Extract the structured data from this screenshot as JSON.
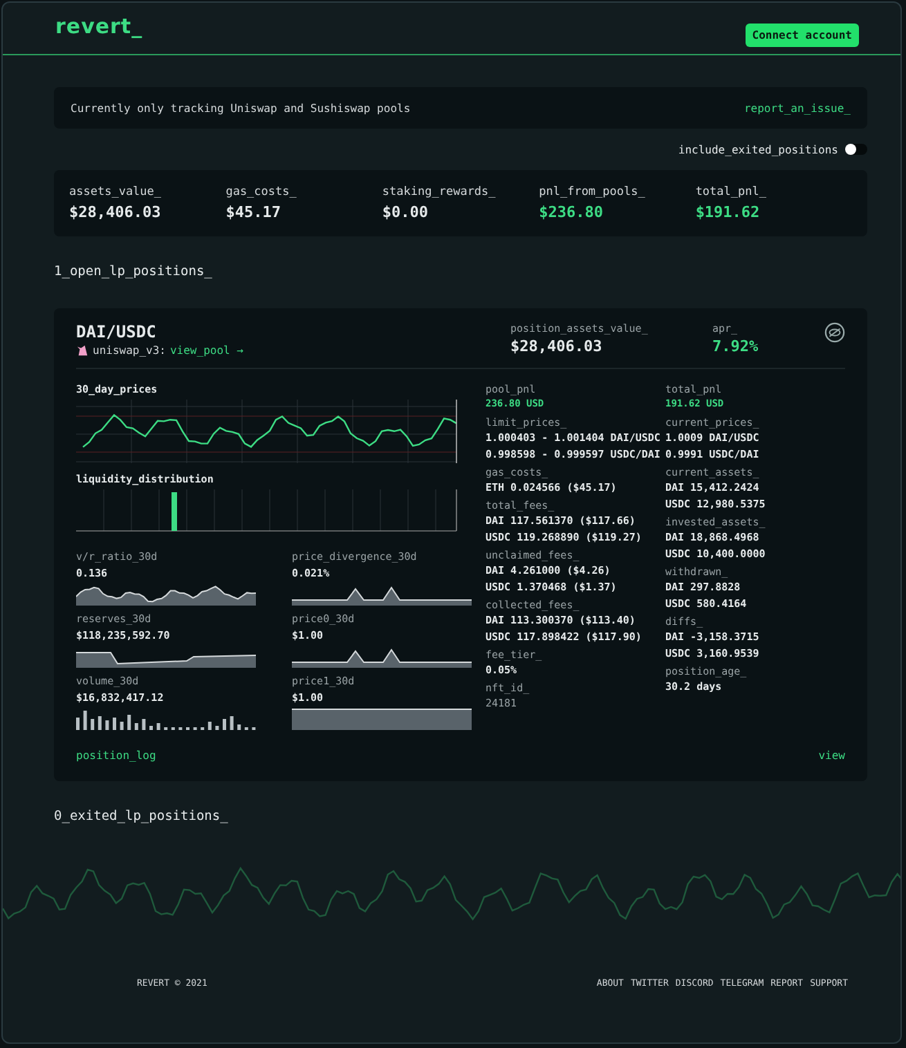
{
  "header": {
    "logo": "revert_",
    "button": "Connect account"
  },
  "notice": {
    "text": "Currently only tracking Uniswap and Sushiswap pools",
    "link": "report_an_issue_"
  },
  "toggle": {
    "label": "include_exited_positions",
    "on": false
  },
  "stats": [
    {
      "label": "assets_value_",
      "value": "$28,406.03",
      "highlight": false
    },
    {
      "label": "gas_costs_",
      "value": "$45.17",
      "highlight": false
    },
    {
      "label": "staking_rewards_",
      "value": "$0.00",
      "highlight": false
    },
    {
      "label": "pnl_from_pools_",
      "value": "$236.80",
      "highlight": true
    },
    {
      "label": "total_pnl_",
      "value": "$191.62",
      "highlight": true
    }
  ],
  "open_title": "1_open_lp_positions_",
  "position": {
    "pair": "DAI/USDC",
    "protocol": "uniswap_v3:",
    "pool_link": "view_pool →",
    "head": [
      {
        "label": "position_assets_value_",
        "value": "$28,406.03",
        "highlight": false
      },
      {
        "label": "apr_",
        "value": "7.92%",
        "highlight": true
      }
    ],
    "price_chart_title": "30_day_prices",
    "liquidity_title": "liquidity_distribution",
    "metrics": [
      {
        "label": "v/r_ratio_30d",
        "value": "0.136",
        "kind": "area"
      },
      {
        "label": "price_divergence_30d",
        "value": "0.021%",
        "kind": "spike"
      },
      {
        "label": "reserves_30d",
        "value": "$118,235,592.70",
        "kind": "step"
      },
      {
        "label": "price0_30d",
        "value": "$1.00",
        "kind": "spike"
      },
      {
        "label": "volume_30d",
        "value": "$16,832,417.12",
        "kind": "bars"
      },
      {
        "label": "price1_30d",
        "value": "$1.00",
        "kind": "flat"
      }
    ],
    "details_left": [
      {
        "label": "pool_pnl",
        "lines": [
          "236.80 USD"
        ],
        "kind": "pnl"
      },
      {
        "label": "limit_prices_",
        "lines": [
          "1.000403 - 1.001404 DAI/USDC",
          "0.998598 - 0.999597 USDC/DAI"
        ],
        "kind": "value"
      },
      {
        "label": "gas_costs_",
        "lines": [
          "ETH 0.024566 ($45.17)"
        ],
        "kind": "value"
      },
      {
        "label": "total_fees_",
        "lines": [
          "DAI 117.561370 ($117.66)",
          "USDC 119.268890 ($119.27)"
        ],
        "kind": "value"
      },
      {
        "label": "unclaimed_fees_",
        "lines": [
          "DAI 4.261000 ($4.26)",
          "USDC 1.370468 ($1.37)"
        ],
        "kind": "value"
      },
      {
        "label": "collected_fees_",
        "lines": [
          "DAI 113.300370 ($113.40)",
          "USDC 117.898422 ($117.90)"
        ],
        "kind": "value"
      },
      {
        "label": "fee_tier_",
        "lines": [
          "0.05%"
        ],
        "kind": "value"
      },
      {
        "label": "nft_id_",
        "lines": [
          "24181"
        ],
        "kind": "dim"
      }
    ],
    "details_right": [
      {
        "label": "total_pnl",
        "lines": [
          "191.62 USD"
        ],
        "kind": "pnl"
      },
      {
        "label": "current_prices_",
        "lines": [
          "1.0009 DAI/USDC",
          "0.9991 USDC/DAI"
        ],
        "kind": "value"
      },
      {
        "label": "current_assets_",
        "lines": [
          "DAI 15,412.2424",
          "USDC 12,980.5375"
        ],
        "kind": "value"
      },
      {
        "label": "invested_assets_",
        "lines": [
          "DAI 18,868.4968",
          "USDC 10,400.0000"
        ],
        "kind": "value"
      },
      {
        "label": "withdrawn_",
        "lines": [
          "DAI 297.8828",
          "USDC 580.4164"
        ],
        "kind": "value"
      },
      {
        "label": "diffs_",
        "lines": [
          "DAI -3,158.3715",
          "USDC 3,160.9539"
        ],
        "kind": "value"
      },
      {
        "label": "position_age_",
        "lines": [
          "30.2 days"
        ],
        "kind": "value"
      }
    ],
    "log_link": "position_log",
    "view_link": "view"
  },
  "exited_title": "0_exited_lp_positions_",
  "footer": {
    "copyright": "REVERT © 2021",
    "links": [
      "ABOUT",
      "TWITTER",
      "DISCORD",
      "TELEGRAM",
      "REPORT",
      "SUPPORT"
    ]
  }
}
